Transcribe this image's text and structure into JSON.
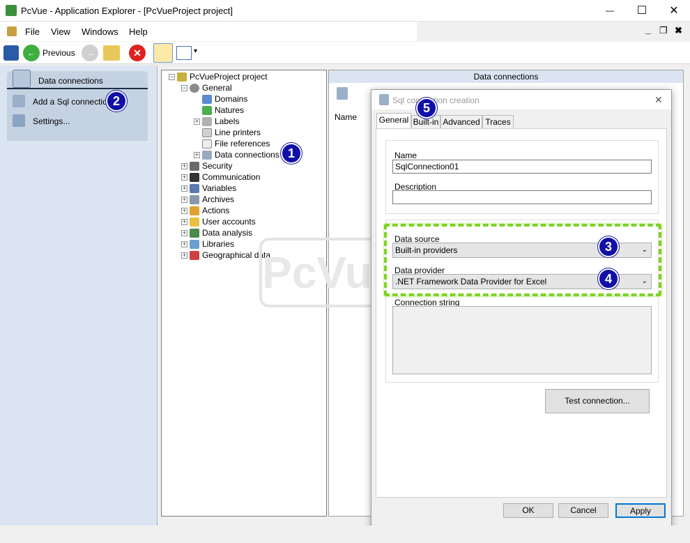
{
  "window": {
    "title": "PcVue - Application Explorer - [PcVueProject project]",
    "minimize": "—",
    "maximize": "☐",
    "close": "✕",
    "mdi_minimize": "_",
    "mdi_restore": "❐",
    "mdi_close": "✖"
  },
  "menu": [
    "File",
    "View",
    "Windows",
    "Help"
  ],
  "toolbar": {
    "previous_label": "Previous",
    "view_dropdown": "▾"
  },
  "leftpane": {
    "group_title": "Data connections",
    "items": [
      "Add a Sql connection",
      "Settings..."
    ]
  },
  "tree": {
    "root": "PcVueProject project",
    "general": "General",
    "general_children": [
      "Domains",
      "Natures",
      "Labels",
      "Line printers",
      "File references",
      "Data connections"
    ],
    "top_items": [
      "Security",
      "Communication",
      "Variables",
      "Archives",
      "Actions",
      "User accounts",
      "Data analysis",
      "Libraries",
      "Geographical data"
    ]
  },
  "rightpane": {
    "header": "Data connections",
    "column_name": "Name",
    "watermark": "PcVue"
  },
  "dialog": {
    "title": "Sql connection creation",
    "tabs": [
      "General",
      "Built-in",
      "Advanced",
      "Traces"
    ],
    "name_label": "Name",
    "name_value": "SqlConnection01",
    "description_label": "Description",
    "description_value": "",
    "data_source_label": "Data source",
    "data_source_value": "Built-in providers",
    "data_provider_label": "Data provider",
    "data_provider_value": ".NET Framework Data Provider for Excel",
    "connection_string_label": "Connection string",
    "test_button": "Test connection...",
    "ok_button": "OK",
    "cancel_button": "Cancel",
    "apply_button": "Apply",
    "close": "✕"
  },
  "badges": [
    "1",
    "2",
    "3",
    "4",
    "5"
  ],
  "colors": {
    "badge": "#1010a8",
    "highlight": "#7ed321",
    "leftpane": "#dbe5f1"
  }
}
